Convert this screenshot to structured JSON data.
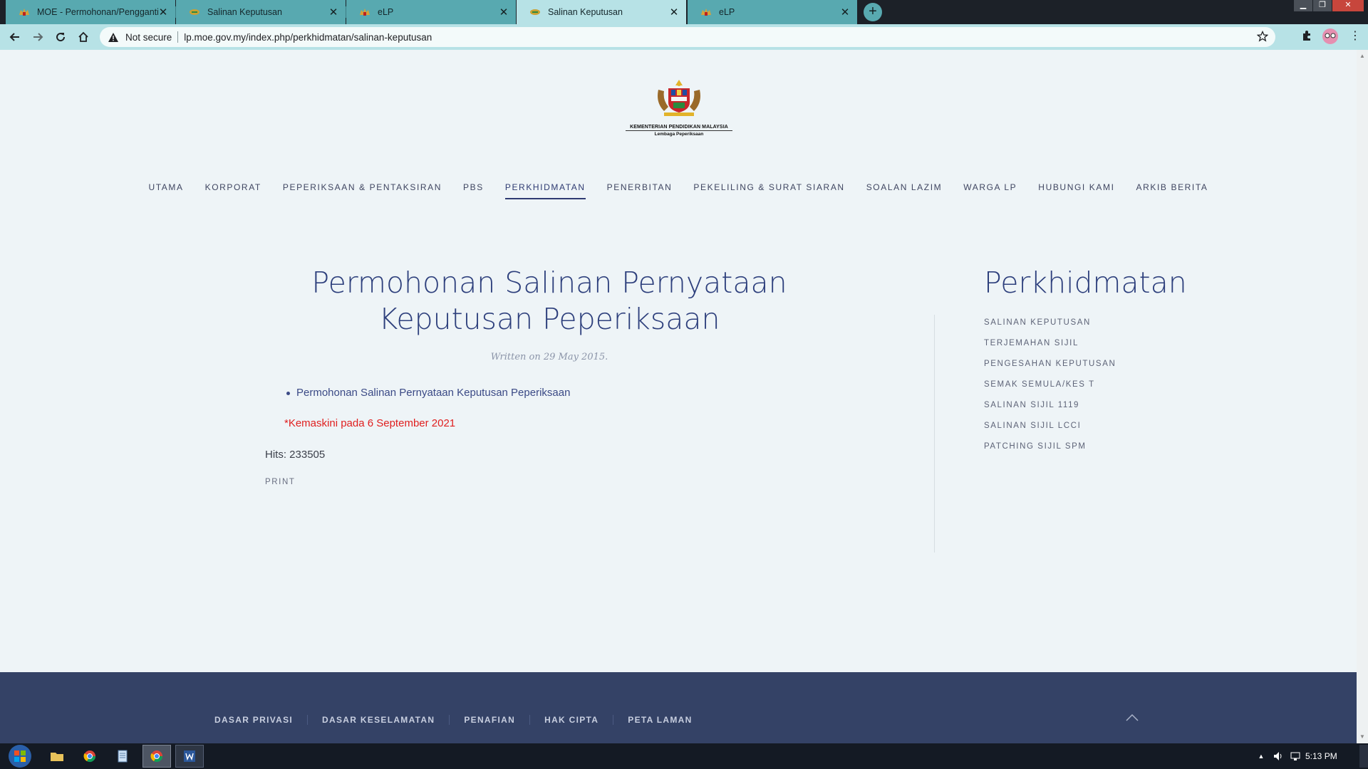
{
  "browser": {
    "tabs": [
      {
        "title": "MOE - Permohonan/Penggantian"
      },
      {
        "title": "Salinan Keputusan"
      },
      {
        "title": "eLP"
      },
      {
        "title": "Salinan Keputusan"
      },
      {
        "title": "eLP"
      }
    ],
    "active_tab": 3,
    "security_label": "Not secure",
    "url": "lp.moe.gov.my/index.php/perkhidmatan/salinan-keputusan"
  },
  "logo": {
    "org": "KEMENTERIAN PENDIDIKAN MALAYSIA",
    "sub": "Lembaga Peperiksaan"
  },
  "nav": [
    {
      "label": "UTAMA"
    },
    {
      "label": "KORPORAT"
    },
    {
      "label": "PEPERIKSAAN & PENTAKSIRAN"
    },
    {
      "label": "PBS"
    },
    {
      "label": "PERKHIDMATAN"
    },
    {
      "label": "PENERBITAN"
    },
    {
      "label": "PEKELILING & SURAT SIARAN"
    },
    {
      "label": "SOALAN LAZIM"
    },
    {
      "label": "WARGA LP"
    },
    {
      "label": "HUBUNGI KAMI"
    },
    {
      "label": "ARKIB BERITA"
    }
  ],
  "nav_active": "PERKHIDMATAN",
  "article": {
    "title": "Permohonan Salinan Pernyataan Keputusan Peperiksaan",
    "written": "Written on 29 May 2015.",
    "links": [
      "Permohonan Salinan Pernyataan Keputusan Peperiksaan"
    ],
    "updated": "*Kemaskini pada 6 September 2021",
    "hits": "Hits: 233505",
    "print": "PRINT"
  },
  "aside": {
    "title": "Perkhidmatan",
    "items": [
      "SALINAN KEPUTUSAN",
      "TERJEMAHAN SIJIL",
      "PENGESAHAN KEPUTUSAN",
      "SEMAK SEMULA/KES T",
      "SALINAN SIJIL 1119",
      "SALINAN SIJIL LCCI",
      "PATCHING SIJIL SPM"
    ]
  },
  "footer": {
    "links": [
      "DASAR PRIVASI",
      "DASAR KESELAMATAN",
      "PENAFIAN",
      "HAK CIPTA",
      "PETA LAMAN"
    ]
  },
  "taskbar": {
    "clock": "5:13 PM"
  },
  "colors": {
    "heading": "#2d3f7c",
    "link": "#3b4a86",
    "alert": "#e02020",
    "footer_bg": "#344266",
    "tab_bg": "#58a9b0",
    "tab_active_bg": "#b7e2e6"
  }
}
